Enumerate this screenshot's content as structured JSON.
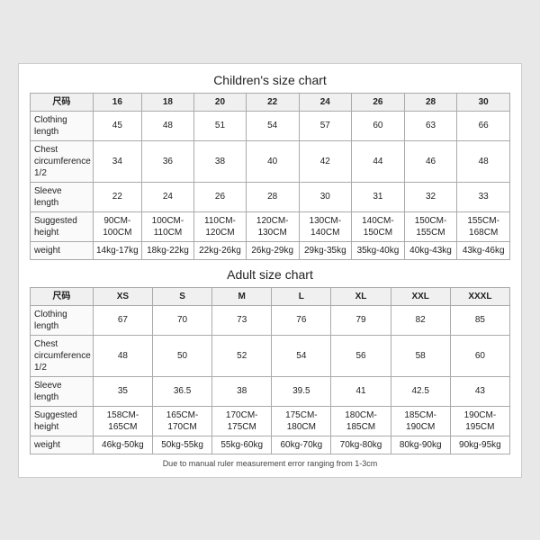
{
  "children_chart": {
    "title": "Children's size chart",
    "columns": [
      "尺码",
      "16",
      "18",
      "20",
      "22",
      "24",
      "26",
      "28",
      "30"
    ],
    "rows": [
      {
        "label": "Clothing\nlength",
        "values": [
          "45",
          "48",
          "51",
          "54",
          "57",
          "60",
          "63",
          "66"
        ]
      },
      {
        "label": "Chest\ncircumference\n1/2",
        "values": [
          "34",
          "36",
          "38",
          "40",
          "42",
          "44",
          "46",
          "48"
        ]
      },
      {
        "label": "Sleeve\nlength",
        "values": [
          "22",
          "24",
          "26",
          "28",
          "30",
          "31",
          "32",
          "33"
        ]
      },
      {
        "label": "Suggested\nheight",
        "values": [
          "90CM-100CM",
          "100CM-110CM",
          "110CM-120CM",
          "120CM-130CM",
          "130CM-140CM",
          "140CM-150CM",
          "150CM-155CM",
          "155CM-168CM"
        ]
      },
      {
        "label": "weight",
        "values": [
          "14kg-17kg",
          "18kg-22kg",
          "22kg-26kg",
          "26kg-29kg",
          "29kg-35kg",
          "35kg-40kg",
          "40kg-43kg",
          "43kg-46kg"
        ]
      }
    ]
  },
  "adult_chart": {
    "title": "Adult size chart",
    "columns": [
      "尺码",
      "XS",
      "S",
      "M",
      "L",
      "XL",
      "XXL",
      "XXXL"
    ],
    "rows": [
      {
        "label": "Clothing\nlength",
        "values": [
          "67",
          "70",
          "73",
          "76",
          "79",
          "82",
          "85"
        ]
      },
      {
        "label": "Chest\ncircumference\n1/2",
        "values": [
          "48",
          "50",
          "52",
          "54",
          "56",
          "58",
          "60"
        ]
      },
      {
        "label": "Sleeve\nlength",
        "values": [
          "35",
          "36.5",
          "38",
          "39.5",
          "41",
          "42.5",
          "43"
        ]
      },
      {
        "label": "Suggested\nheight",
        "values": [
          "158CM-165CM",
          "165CM-170CM",
          "170CM-175CM",
          "175CM-180CM",
          "180CM-185CM",
          "185CM-190CM",
          "190CM-195CM"
        ]
      },
      {
        "label": "weight",
        "values": [
          "46kg-50kg",
          "50kg-55kg",
          "55kg-60kg",
          "60kg-70kg",
          "70kg-80kg",
          "80kg-90kg",
          "90kg-95kg"
        ]
      }
    ]
  },
  "footer": {
    "note": "Due to manual ruler measurement error ranging from 1-3cm"
  }
}
